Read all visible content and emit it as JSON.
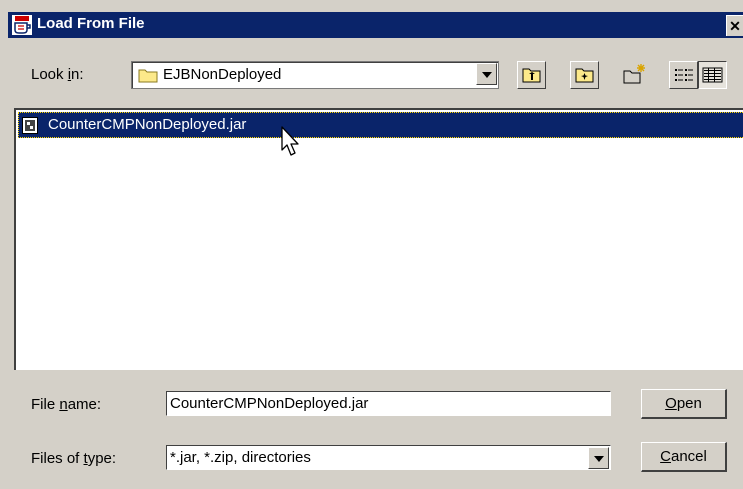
{
  "window": {
    "title": "Load From File",
    "close_glyph": "✕"
  },
  "look_in": {
    "label_pre": "Look ",
    "label_mnemonic": "i",
    "label_post": "n:",
    "folder": "EJBNonDeployed",
    "folder_icon": "folder-icon"
  },
  "toolbar": {
    "icons": [
      "up-folder-icon",
      "home-folder-icon",
      "new-folder-icon",
      "list-view-icon",
      "details-view-icon"
    ]
  },
  "files": [
    {
      "name": "CounterCMPNonDeployed.jar",
      "icon": "jar-file-icon",
      "selected": true
    }
  ],
  "file_name": {
    "label_pre": "File ",
    "label_mnemonic": "n",
    "label_post": "ame:",
    "value": "CounterCMPNonDeployed.jar"
  },
  "file_type": {
    "label_pre": "Files of ",
    "label_mnemonic": "t",
    "label_post": "ype:",
    "value": "*.jar, *.zip, directories"
  },
  "buttons": {
    "open_mnemonic": "O",
    "open_rest": "pen",
    "cancel_mnemonic": "C",
    "cancel_rest": "ancel"
  },
  "colors": {
    "title_bar": "#0a246a",
    "selection": "#0a246a",
    "panel": "#d4d0c8"
  }
}
